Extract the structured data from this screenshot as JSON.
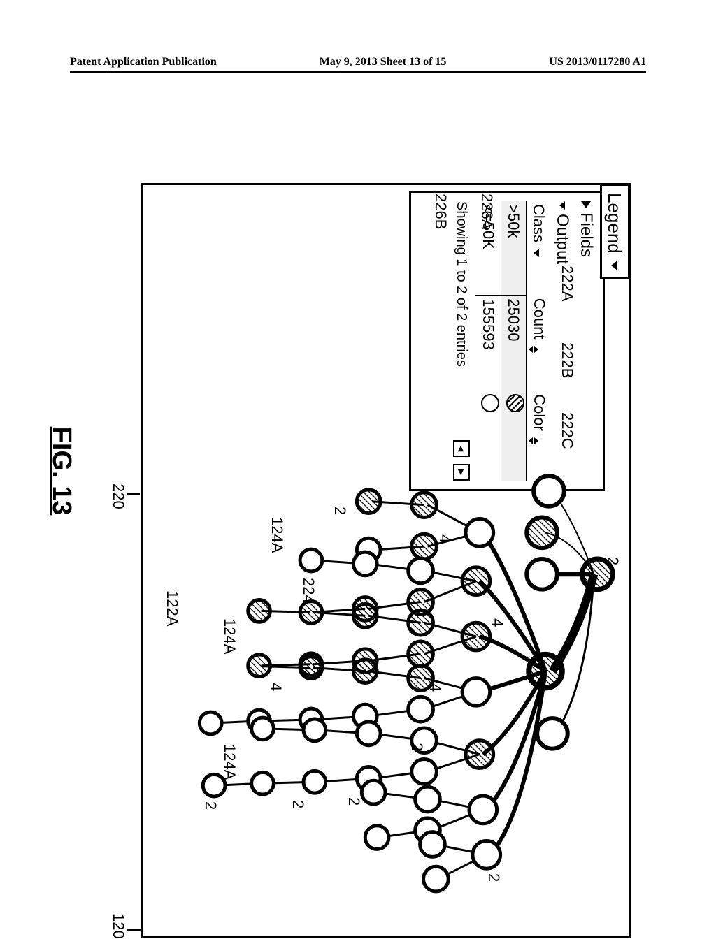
{
  "header": {
    "left": "Patent Application Publication",
    "center": "May 9, 2013  Sheet 13 of 15",
    "right": "US 2013/0117280 A1"
  },
  "legend": {
    "tab": "Legend",
    "fields_label": "Fields",
    "output_label": "Output",
    "columns": {
      "class": "Class",
      "count": "Count",
      "color": "Color"
    },
    "rows": [
      {
        "class": ">50k",
        "count": "25030",
        "color": "hatched"
      },
      {
        "class": "<=50K",
        "count": "155593",
        "color": "plain"
      }
    ],
    "status_text": "Showing 1 to 2 of 2 entries",
    "pager": {
      "prev": "◄",
      "next": "►"
    }
  },
  "refs": {
    "r222A": "222A",
    "r222B": "222B",
    "r222C": "222C",
    "r226A": "226A",
    "r226B": "226B",
    "r120": "120",
    "r220": "220",
    "r224": "224",
    "r122A": "122A",
    "r124A": "124A",
    "two": "2",
    "four": "4"
  },
  "caption": "FIG. 13"
}
